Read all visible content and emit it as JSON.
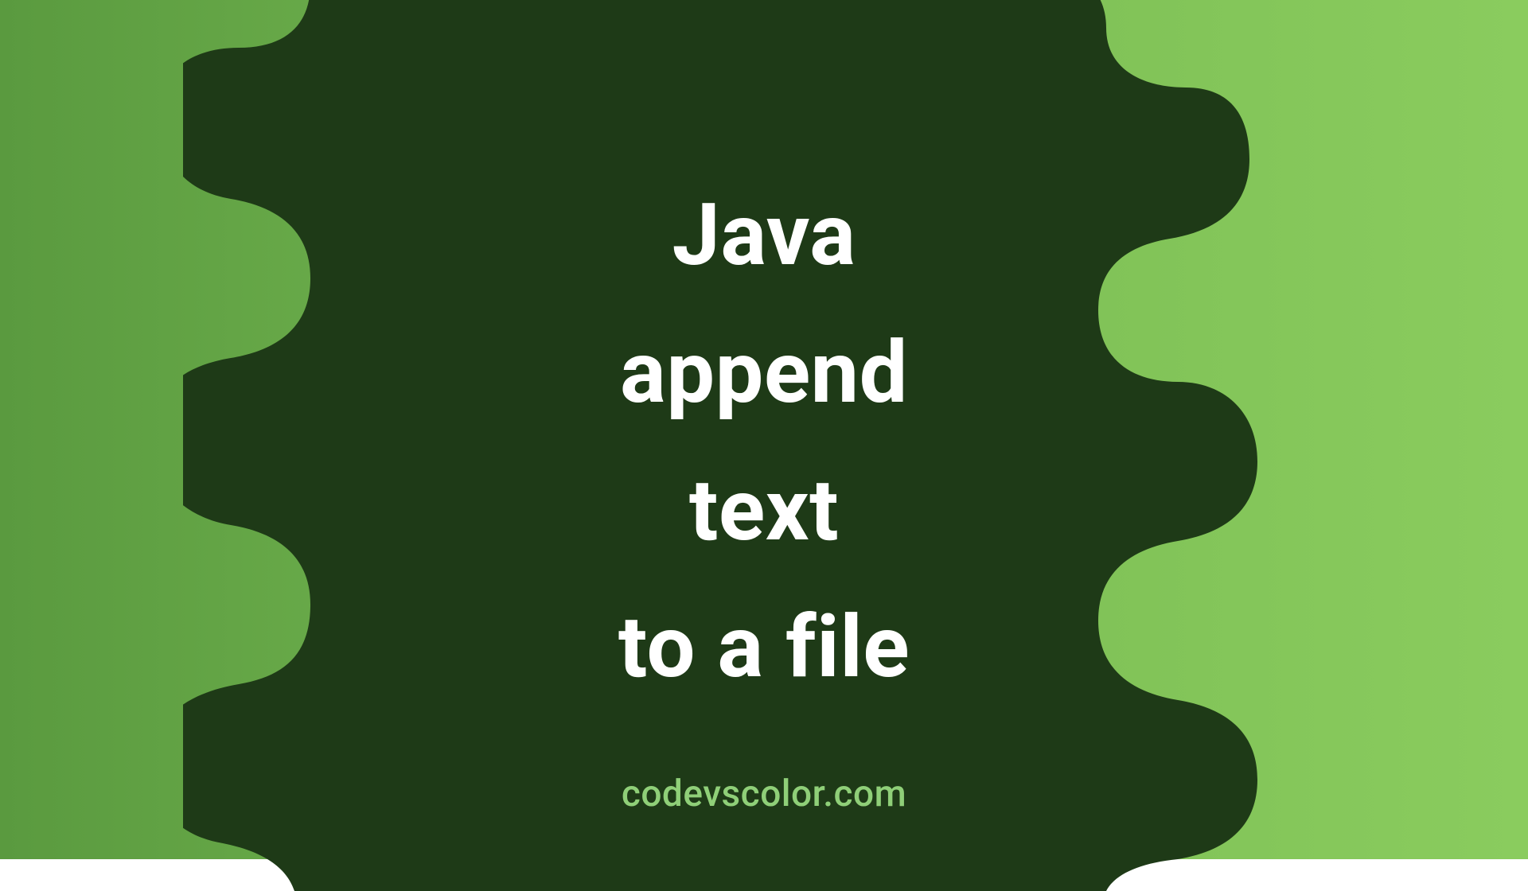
{
  "title": {
    "line1": "Java",
    "line2": "append",
    "line3": "text",
    "line4": "to a file"
  },
  "site": "codevscolor.com",
  "colors": {
    "blob": "#1e3a17",
    "text": "#ffffff",
    "site": "#8fcf78",
    "bg_left": "#5a9a3f",
    "bg_right": "#8acc5e"
  }
}
